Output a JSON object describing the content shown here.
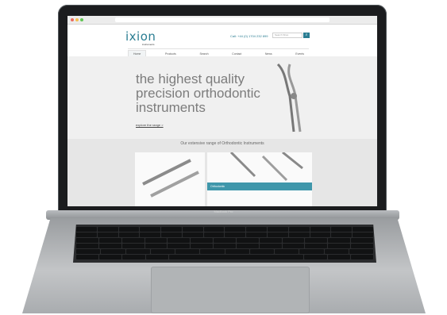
{
  "site": {
    "logo": "ixion",
    "logo_sub": "instruments",
    "phone": "Call: +44 (0) 1704 232 899",
    "search_placeholder": "Search Shop",
    "nav": [
      "Home",
      "Products",
      "Search",
      "Contact",
      "News",
      "Events"
    ],
    "hero_line1": "the highest quality",
    "hero_line2": "precision orthodontic",
    "hero_line3": "instruments",
    "hero_link": "explore the range >",
    "range_title": "Our extensive range of Orthodontic Instruments",
    "card_label": "Orthodontic"
  },
  "device": {
    "label": "MacBook Pro"
  },
  "colors": {
    "accent": "#2a7d92",
    "card_bar": "#3f97ab",
    "bezel": "#1b1c1e",
    "chassis": "#b1b4b6"
  },
  "icons": [
    "search-icon",
    "plier-icon"
  ]
}
